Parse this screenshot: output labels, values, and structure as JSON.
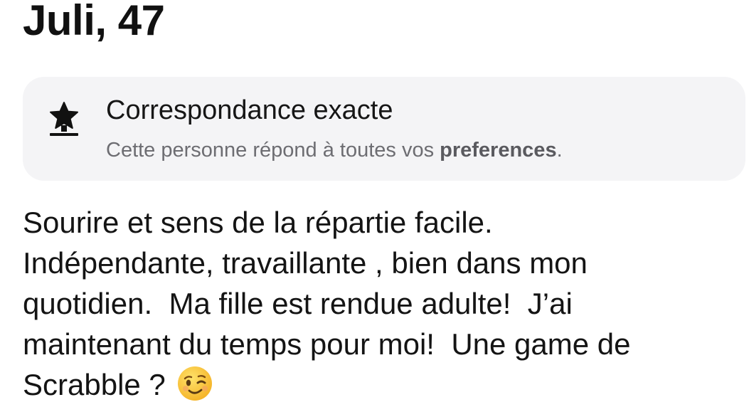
{
  "profile": {
    "name_age": "Juli, 47"
  },
  "match_card": {
    "icon": "star-award-icon",
    "title": "Correspondance exacte",
    "subtitle_prefix": "Cette personne répond à toutes vos ",
    "subtitle_bold": "preferences",
    "subtitle_suffix": "."
  },
  "bio": {
    "lines": [
      "Sourire et sens de la répartie facile.",
      "Indépendante, travaillante , bien dans mon",
      "quotidien.  Ma fille est rendue adulte!  J’ai",
      "maintenant du temps pour moi!  Une game de",
      "Scrabble ? "
    ],
    "emoji": "winking-face-emoji"
  },
  "colors": {
    "card_background": "#f4f4f6",
    "subtitle_text": "#6d6d72",
    "emoji_face": "#ffcc3d"
  }
}
